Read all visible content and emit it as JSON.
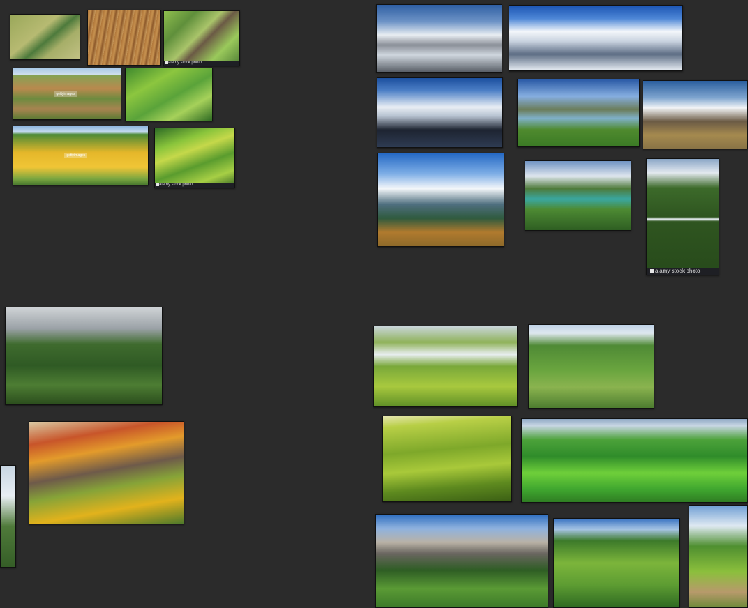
{
  "canvas": {
    "background": "#2b2b2b"
  },
  "images": [
    {
      "id": "img-field-curve",
      "subject": "aerial-farm",
      "bg": "linear-gradient(140deg,#9aa85a 0%,#b7ba72 40%,#4d7a3c 55%,#a6ae68 70%,#c2c184 100%)"
    },
    {
      "id": "img-plowed-field",
      "subject": "aerial-farm",
      "bg": "repeating-linear-gradient(100deg,#b0773a 0px,#c6914f 4px,#8e5a2b 7px,#c99a5c 11px)"
    },
    {
      "id": "img-patchwork-1",
      "subject": "aerial-farm",
      "bg": "linear-gradient(135deg,#8fbf4e 0%,#5f8f3b 25%,#a9c46a 45%,#6b5a45 55%,#9ac95b 75%,#4e7d34 100%)",
      "caption": "alamy stock photo"
    },
    {
      "id": "img-patchwork-2",
      "subject": "aerial-farm",
      "bg": "linear-gradient(180deg,#a9c9e8 0%,#cfe0ee 12%,#86a255 14%,#b9894e 40%,#6d8b3f 60%,#a88450 80%,#5b7b33 100%)",
      "watermark": "gettyimages"
    },
    {
      "id": "img-green-valley",
      "subject": "aerial-farm",
      "bg": "linear-gradient(150deg,#3f8a2e 0%,#8cc63f 30%,#5aa33a 55%,#a6d15a 75%,#2f6b23 100%)"
    },
    {
      "id": "img-yellow-field",
      "subject": "aerial-farm",
      "bg": "linear-gradient(180deg,#8fb6de 0%,#c6dbef 10%,#4d8a36 14%,#e5b72a 45%,#f0c536 70%,#7aa640 90%,#4b7a2f 100%)",
      "watermark": "gettyimages"
    },
    {
      "id": "img-green-strips",
      "subject": "aerial-farm",
      "bg": "linear-gradient(160deg,#2d6b25 0%,#89c43b 25%,#c5d84a 40%,#5a9c2e 60%,#a7cf45 80%,#2f5f22 100%)",
      "caption": "alamy stock photo"
    },
    {
      "id": "img-everest-1",
      "subject": "snow-mountain",
      "bg": "linear-gradient(180deg,#2f5fa3 0%,#6d93c6 25%,#e8edf2 45%,#8a8f98 60%,#cfd6de 75%,#5a6068 100%)"
    },
    {
      "id": "img-alps-snow",
      "subject": "snow-mountain",
      "bg": "linear-gradient(180deg,#1c55b3 0%,#4d86d6 20%,#f3f6fa 40%,#c9d3e0 55%,#5d6d84 75%,#e6ecf2 100%)"
    },
    {
      "id": "img-everest-2",
      "subject": "snow-mountain",
      "bg": "linear-gradient(180deg,#1b4f9e 0%,#4c7fc6 18%,#e9eef4 42%,#b7c3d1 55%,#1d2431 75%,#2e3b52 100%)"
    },
    {
      "id": "img-lake-valley",
      "subject": "mountain-lake",
      "bg": "linear-gradient(180deg,#2a5aa6 0%,#86aee0 25%,#6b7d5a 45%,#7fb0c8 58%,#4f8a2e 75%,#3b7a25 100%)"
    },
    {
      "id": "img-peak-plain",
      "subject": "snow-mountain",
      "bg": "linear-gradient(180deg,#2a5e9e 0%,#7fa5cf 25%,#f2f4f6 40%,#6b5b45 60%,#a58a4f 80%,#8a7446 100%)"
    },
    {
      "id": "img-range-meadow",
      "subject": "snow-mountain",
      "bg": "linear-gradient(180deg,#2569c4 0%,#7eaee6 22%,#f4f7fa 38%,#4f6f7f 55%,#2f5a3e 70%,#b07a2e 85%,#8e6a2a 100%)"
    },
    {
      "id": "img-turquoise-lake",
      "subject": "mountain-lake",
      "bg": "linear-gradient(180deg,#6f93c2 0%,#dfe6ee 22%,#4e7a3a 40%,#3aa7a0 55%,#4d8a33 70%,#2e5e22 100%)"
    },
    {
      "id": "img-waterfall-gorge",
      "subject": "waterfall",
      "bg": "linear-gradient(180deg,#8aa6c6 0%,#e3e9ef 12%,#3c6a2a 25%,#2f5520 50%,#e8eef3 52%,#2f5520 54%,#274a1b 100%)",
      "caption": "alamy stock photo"
    },
    {
      "id": "img-tropical-falls",
      "subject": "waterfall",
      "bg": "linear-gradient(180deg,#cfd3d6 0%,#9aa1a6 22%,#3f6b2e 38%,#2f5a24 60%,#4d7d33 80%,#2b4d1d 100%)"
    },
    {
      "id": "img-autumn-cliff",
      "subject": "autumn-forest",
      "bg": "linear-gradient(170deg,#d9c9a3 0%,#c8552a 18%,#e39b2b 32%,#6e5a4a 48%,#86a338 62%,#e2b21c 80%,#4f7a2b 100%)"
    },
    {
      "id": "img-partial-left",
      "subject": "partial",
      "bg": "linear-gradient(180deg,#c8d6e2 0%,#e8eef3 30%,#4f7a3a 60%,#355e27 100%)"
    },
    {
      "id": "img-misty-hills",
      "subject": "green-hills",
      "bg": "linear-gradient(180deg,#c9d6da 0%,#8fb25a 20%,#e8eef0 35%,#79a83a 50%,#a8c93e 75%,#5f8f27 100%)"
    },
    {
      "id": "img-green-mountains",
      "subject": "green-hills",
      "bg": "linear-gradient(180deg,#bfd2e6 0%,#dfe8ef 10%,#4f8a35 25%,#6aa53f 55%,#8ab34f 75%,#4e7d30 100%)"
    },
    {
      "id": "img-rolling-hills",
      "subject": "green-hills",
      "bg": "linear-gradient(175deg,#e6e6b0 0%,#b8cf46 12%,#7ea82a 40%,#a9c93a 60%,#5e8a1f 80%,#3b5f14 100%)"
    },
    {
      "id": "img-bright-hills",
      "subject": "green-hills",
      "bg": "linear-gradient(180deg,#8fa8c4 0%,#c8d6e4 8%,#4ca23a 25%,#2f8c2a 45%,#6fcf3a 65%,#3fa62f 85%,#2f7d23 100%)"
    },
    {
      "id": "img-dolomites",
      "subject": "alpine-village",
      "bg": "linear-gradient(180deg,#2f6fc0 0%,#8fb2de 15%,#b9b2a6 30%,#6a6660 42%,#2e5d24 60%,#5a9a35 80%,#3d7a29 100%)"
    },
    {
      "id": "img-forest-hills",
      "subject": "green-hills",
      "bg": "linear-gradient(180deg,#3b74c2 0%,#a6c4e4 12%,#3c7a2a 25%,#7cb53b 50%,#5d9c32 75%,#2f6a22 100%)"
    },
    {
      "id": "img-path-meadow",
      "subject": "green-hills",
      "bg": "linear-gradient(180deg,#6f9fd4 0%,#dfe9f2 20%,#4f8f30 40%,#8bbf3c 65%,#b79a6b 85%,#6f8a3a 100%)"
    }
  ]
}
